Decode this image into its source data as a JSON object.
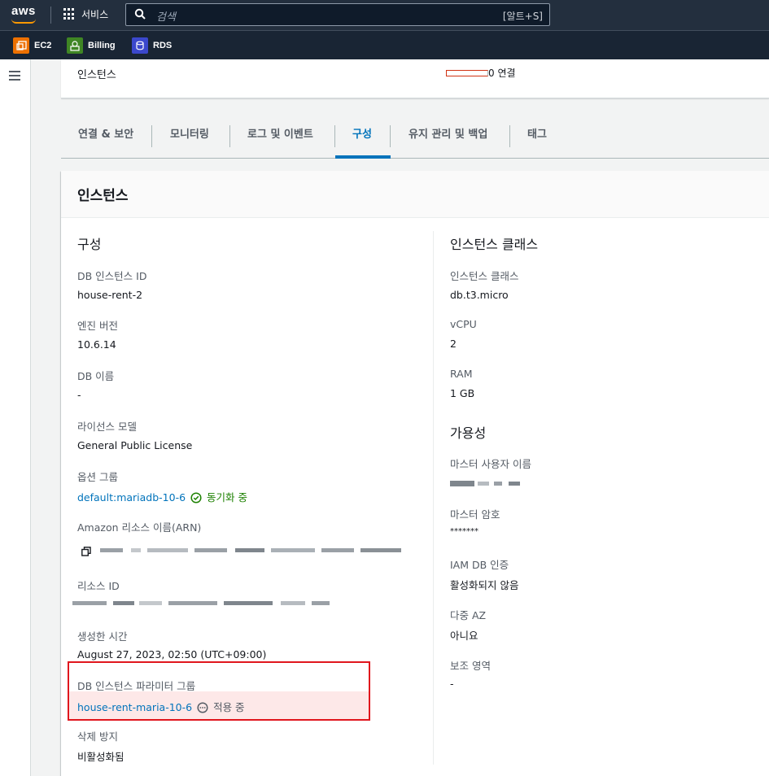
{
  "topbar": {
    "logo": "aws",
    "services_label": "서비스",
    "search_placeholder": "검색",
    "search_shortcut": "[알트+S]"
  },
  "favorites": [
    {
      "label": "EC2",
      "icon": "ec2-icon",
      "color": "#ed7100"
    },
    {
      "label": "Billing",
      "icon": "billing-icon",
      "color": "#3f8624"
    },
    {
      "label": "RDS",
      "icon": "rds-icon",
      "color": "#3b48cc"
    }
  ],
  "summary": {
    "instance_label": "인스턴스",
    "connections": "0 연결"
  },
  "tabs": [
    {
      "label": "연결 & 보안",
      "active": false
    },
    {
      "label": "모니터링",
      "active": false
    },
    {
      "label": "로그 및 이벤트",
      "active": false
    },
    {
      "label": "구성",
      "active": true
    },
    {
      "label": "유지 관리 및 백업",
      "active": false
    },
    {
      "label": "태그",
      "active": false
    }
  ],
  "panel": {
    "title": "인스턴스",
    "left": {
      "section_title": "구성",
      "instance_id_label": "DB 인스턴스 ID",
      "instance_id": "house-rent-2",
      "engine_version_label": "엔진 버전",
      "engine_version": "10.6.14",
      "db_name_label": "DB 이름",
      "db_name": "-",
      "license_label": "라이선스 모델",
      "license": "General Public License",
      "option_group_label": "옵션 그룹",
      "option_group": "default:mariadb-10-6",
      "option_group_status": "동기화 중",
      "arn_label": "Amazon 리소스 이름(ARN)",
      "resource_id_label": "리소스 ID",
      "created_label": "생성한 시간",
      "created": "August 27, 2023, 02:50 (UTC+09:00)",
      "param_group_label": "DB 인스턴스 파라미터 그룹",
      "param_group": "house-rent-maria-10-6",
      "param_group_status": "적용 중",
      "deletion_protection_label": "삭제 방지",
      "deletion_protection": "비활성화됨"
    },
    "right": {
      "class_section_title": "인스턴스 클래스",
      "class_label": "인스턴스 클래스",
      "class": "db.t3.micro",
      "vcpu_label": "vCPU",
      "vcpu": "2",
      "ram_label": "RAM",
      "ram": "1 GB",
      "availability_title": "가용성",
      "master_user_label": "마스터 사용자 이름",
      "master_password_label": "마스터 암호",
      "master_password": "*******",
      "iam_auth_label": "IAM DB 인증",
      "iam_auth": "활성화되지 않음",
      "multi_az_label": "다중 AZ",
      "multi_az": "아니요",
      "secondary_zone_label": "보조 영역",
      "secondary_zone": "-"
    }
  }
}
